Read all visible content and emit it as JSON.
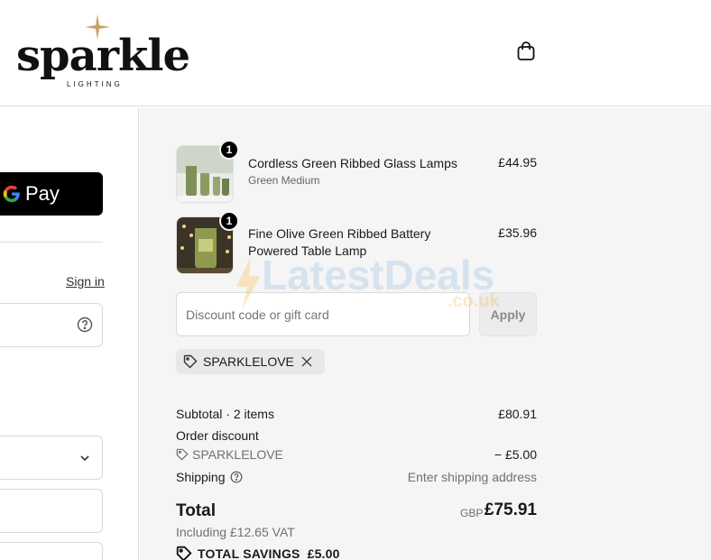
{
  "header": {
    "logo_word": "sparkle",
    "logo_sub": "LIGHTING",
    "bag_icon": "shopping-bag-icon"
  },
  "left_panel": {
    "gpay_label": "Pay",
    "sign_in": "Sign in"
  },
  "order": {
    "items": [
      {
        "title": "Cordless Green Ribbed Glass Lamps",
        "variant": "Green Medium",
        "price": "£44.95",
        "quantity": "1"
      },
      {
        "title": "Fine Olive Green Ribbed Battery Powered Table Lamp",
        "variant": "",
        "price": "£35.96",
        "quantity": "1"
      }
    ],
    "discount": {
      "placeholder": "Discount code or gift card",
      "apply_label": "Apply",
      "applied_code": "SPARKLELOVE"
    },
    "summary": {
      "subtotal_label": "Subtotal · 2 items",
      "subtotal_value": "£80.91",
      "order_discount_label": "Order discount",
      "discount_code": "SPARKLELOVE",
      "discount_value": "− £5.00",
      "shipping_label": "Shipping",
      "shipping_value": "Enter shipping address",
      "total_label": "Total",
      "total_currency": "GBP",
      "total_value": "£75.91",
      "vat_note": "Including £12.65 VAT",
      "savings_label": "TOTAL SAVINGS",
      "savings_value": "£5.00"
    }
  },
  "watermark": {
    "text": "LatestDeals",
    "sub": ".co.uk"
  },
  "colors": {
    "summary_bg": "#f5f5f5",
    "button_dark": "#000000",
    "muted_text": "#707070"
  }
}
